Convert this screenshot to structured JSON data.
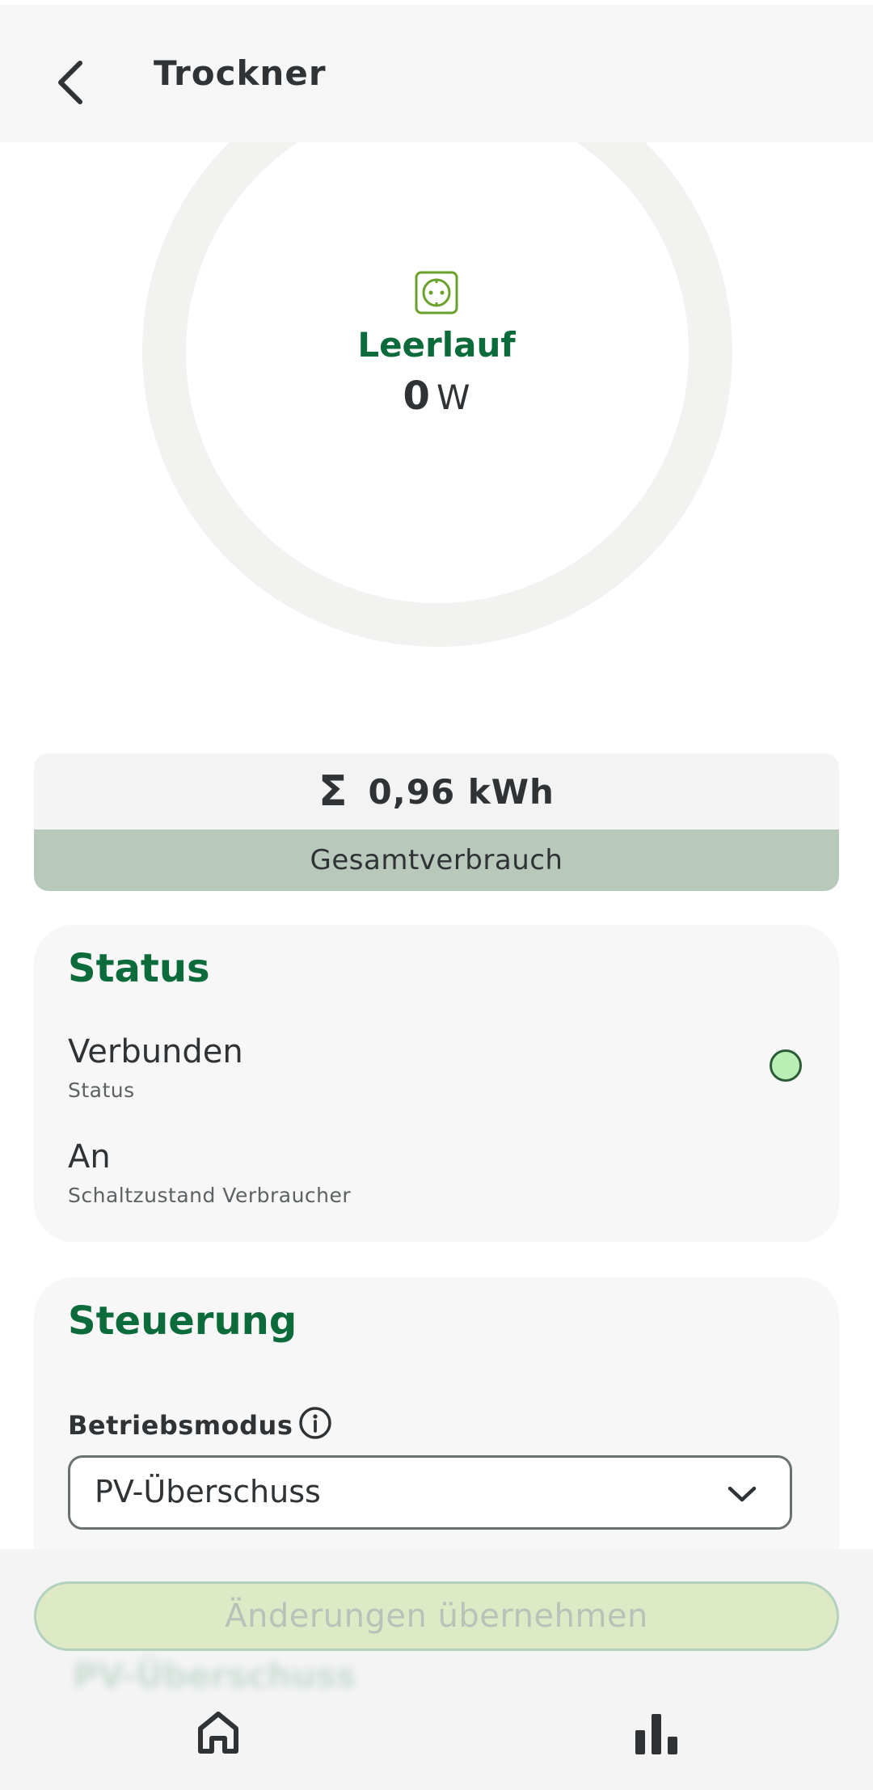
{
  "header": {
    "title": "Trockner"
  },
  "gauge": {
    "state_label": "Leerlauf",
    "power_value": "0",
    "power_unit": "W",
    "level": 0
  },
  "total": {
    "symbol": "Σ",
    "value": "0,96 kWh",
    "label": "Gesamtverbrauch"
  },
  "status_card": {
    "title": "Status",
    "rows": [
      {
        "value": "Verbunden",
        "label": "Status"
      },
      {
        "value": "An",
        "label": "Schaltzustand Verbraucher"
      }
    ],
    "indicator_color": "#b9efb4"
  },
  "control_card": {
    "title": "Steuerung",
    "mode_label": "Betriebsmodus",
    "mode_value": "PV-Überschuss"
  },
  "apply_button": {
    "label": "Änderungen übernehmen"
  },
  "blurred_text": "PV-Überschuss",
  "colors": {
    "brand_green": "#0c6b3b",
    "accent_light": "#deeac6"
  }
}
